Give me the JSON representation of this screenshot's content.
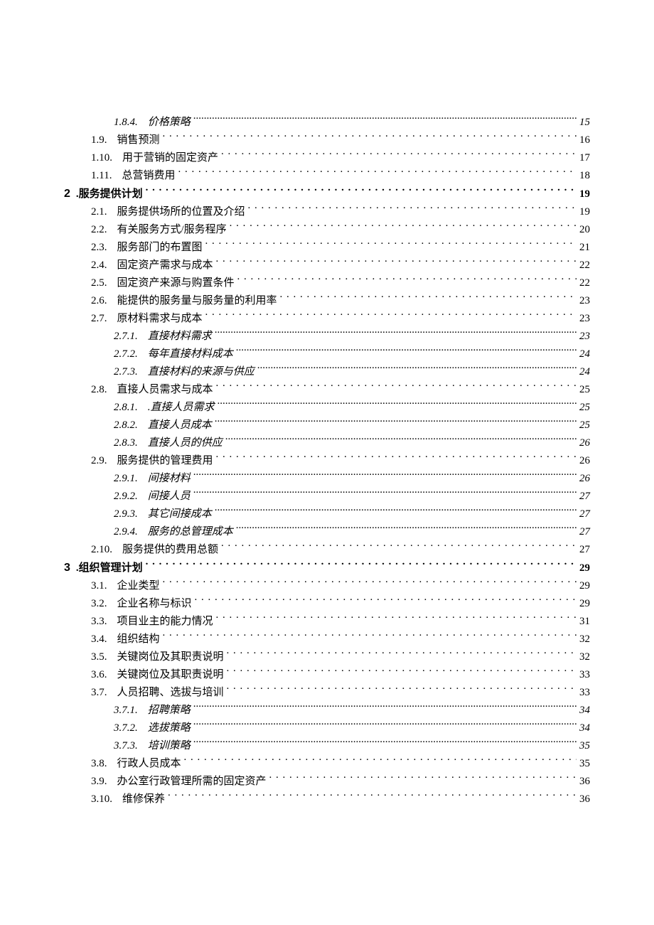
{
  "toc": [
    {
      "level": 3,
      "num": "1.8.4.",
      "title": "价格策略",
      "page": "15",
      "italic": true,
      "dense": true
    },
    {
      "level": 2,
      "num": "1.9.",
      "title": "销售预测",
      "page": "16"
    },
    {
      "level": 2,
      "num": "1.10.",
      "title": "用于营销的固定资产",
      "page": "17"
    },
    {
      "level": 2,
      "num": "1.11.",
      "title": "总营销费用",
      "page": "18"
    },
    {
      "level": 1,
      "num": "2",
      "title": ".服务提供计划",
      "page": "19",
      "bold": true,
      "chapter": true
    },
    {
      "level": 2,
      "num": "2.1.",
      "title": "服务提供场所的位置及介绍",
      "page": "19"
    },
    {
      "level": 2,
      "num": "2.2.",
      "title": "有关服务方式/服务程序",
      "page": "20"
    },
    {
      "level": 2,
      "num": "2.3.",
      "title": "服务部门的布置图",
      "page": "21"
    },
    {
      "level": 2,
      "num": "2.4.",
      "title": "固定资产需求与成本",
      "page": "22"
    },
    {
      "level": 2,
      "num": "2.5.",
      "title": "固定资产来源与购置条件",
      "page": "22"
    },
    {
      "level": 2,
      "num": "2.6.",
      "title": "能提供的服务量与服务量的利用率",
      "page": "23"
    },
    {
      "level": 2,
      "num": "2.7.",
      "title": "原材料需求与成本",
      "page": "23"
    },
    {
      "level": 3,
      "num": "2.7.1.",
      "title": "直接材料需求",
      "page": "23",
      "italic": true,
      "dense": true
    },
    {
      "level": 3,
      "num": "2.7.2.",
      "title": "每年直接材料成本",
      "page": "24",
      "italic": true,
      "dense": true
    },
    {
      "level": 3,
      "num": "2.7.3.",
      "title": "直接材料的来源与供应",
      "page": "24",
      "italic": true,
      "dense": true
    },
    {
      "level": 2,
      "num": "2.8.",
      "title": "直接人员需求与成本",
      "page": "25"
    },
    {
      "level": 3,
      "num": "2.8.1.",
      "title": ".直接人员需求",
      "page": "25",
      "italic": true,
      "dense": true
    },
    {
      "level": 3,
      "num": "2.8.2.",
      "title": "直接人员成本",
      "page": "25",
      "italic": true,
      "dense": true
    },
    {
      "level": 3,
      "num": "2.8.3.",
      "title": "直接人员的供应",
      "page": "26",
      "italic": true,
      "dense": true
    },
    {
      "level": 2,
      "num": "2.9.",
      "title": "服务提供的管理费用",
      "page": "26"
    },
    {
      "level": 3,
      "num": "2.9.1.",
      "title": "间接材料",
      "page": "26",
      "italic": true,
      "dense": true
    },
    {
      "level": 3,
      "num": "2.9.2.",
      "title": "间接人员",
      "page": "27",
      "italic": true,
      "dense": true
    },
    {
      "level": 3,
      "num": "2.9.3.",
      "title": "其它间接成本",
      "page": "27",
      "italic": true,
      "dense": true
    },
    {
      "level": 3,
      "num": "2.9.4.",
      "title": "服务的总管理成本",
      "page": "27",
      "italic": true,
      "dense": true
    },
    {
      "level": 2,
      "num": "2.10.",
      "title": "服务提供的费用总额",
      "page": "27"
    },
    {
      "level": 1,
      "num": "3",
      "title": ".组织管理计划",
      "page": "29",
      "bold": true,
      "chapter": true
    },
    {
      "level": 2,
      "num": "3.1.",
      "title": "企业类型",
      "page": "29"
    },
    {
      "level": 2,
      "num": "3.2.",
      "title": "企业名称与标识",
      "page": "29"
    },
    {
      "level": 2,
      "num": "3.3.",
      "title": "项目业主的能力情况",
      "page": "31"
    },
    {
      "level": 2,
      "num": "3.4.",
      "title": "组织结构",
      "page": "32"
    },
    {
      "level": 2,
      "num": "3.5.",
      "title": "关键岗位及其职责说明",
      "page": "32"
    },
    {
      "level": 2,
      "num": "3.6.",
      "title": "关键岗位及其职责说明",
      "page": "33"
    },
    {
      "level": 2,
      "num": "3.7.",
      "title": "人员招聘、选拔与培训",
      "page": "33"
    },
    {
      "level": 3,
      "num": "3.7.1.",
      "title": "招聘策略",
      "page": "34",
      "italic": true,
      "dense": true
    },
    {
      "level": 3,
      "num": "3.7.2.",
      "title": "选拔策略",
      "page": "34",
      "italic": true,
      "dense": true
    },
    {
      "level": 3,
      "num": "3.7.3.",
      "title": "培训策略",
      "page": "35",
      "italic": true,
      "dense": true
    },
    {
      "level": 2,
      "num": "3.8.",
      "title": "行政人员成本",
      "page": "35"
    },
    {
      "level": 2,
      "num": "3.9.",
      "title": "办公室行政管理所需的固定资产",
      "page": "36"
    },
    {
      "level": 2,
      "num": "3.10.",
      "title": "维修保养",
      "page": "36"
    }
  ]
}
